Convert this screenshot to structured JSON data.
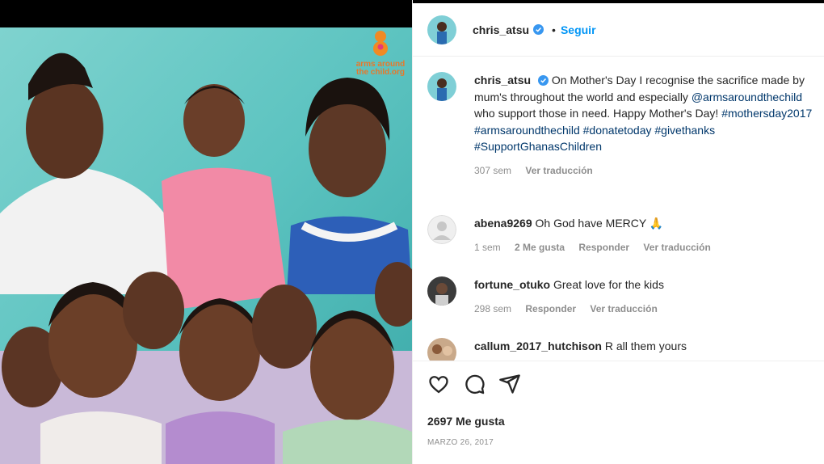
{
  "post": {
    "image_alt": "Group photo of children with two adults",
    "logo_text": "arms around the child.org"
  },
  "header": {
    "username": "chris_atsu",
    "dot": "•",
    "follow_label": "Seguir"
  },
  "caption": {
    "username": "chris_atsu",
    "text_1": "On Mother's Day I recognise the sacrifice made by mum's throughout the world and especially ",
    "mention": "@armsaroundthechild",
    "text_2": " who support those in need. Happy Mother's Day! ",
    "hashtags": "#mothersday2017 #armsaroundthechild #donatetoday #givethanks #SupportGhanasChildren",
    "time": "307 sem",
    "translate": "Ver traducción"
  },
  "comments": [
    {
      "username": "abena9269",
      "text": "Oh God have MERCY 🙏",
      "time": "1 sem",
      "likes": "2 Me gusta",
      "reply": "Responder",
      "translate": "Ver traducción"
    },
    {
      "username": "fortune_otuko",
      "text": "Great love for the kids",
      "time": "298 sem",
      "reply": "Responder",
      "translate": "Ver traducción"
    },
    {
      "username": "callum_2017_hutchison",
      "text": "R all them yours"
    }
  ],
  "footer": {
    "likes": "2697 Me gusta",
    "date": "MARZO 26, 2017"
  },
  "colors": {
    "link": "#00376b",
    "accent": "#0095f6",
    "muted": "#8e8e8e"
  }
}
